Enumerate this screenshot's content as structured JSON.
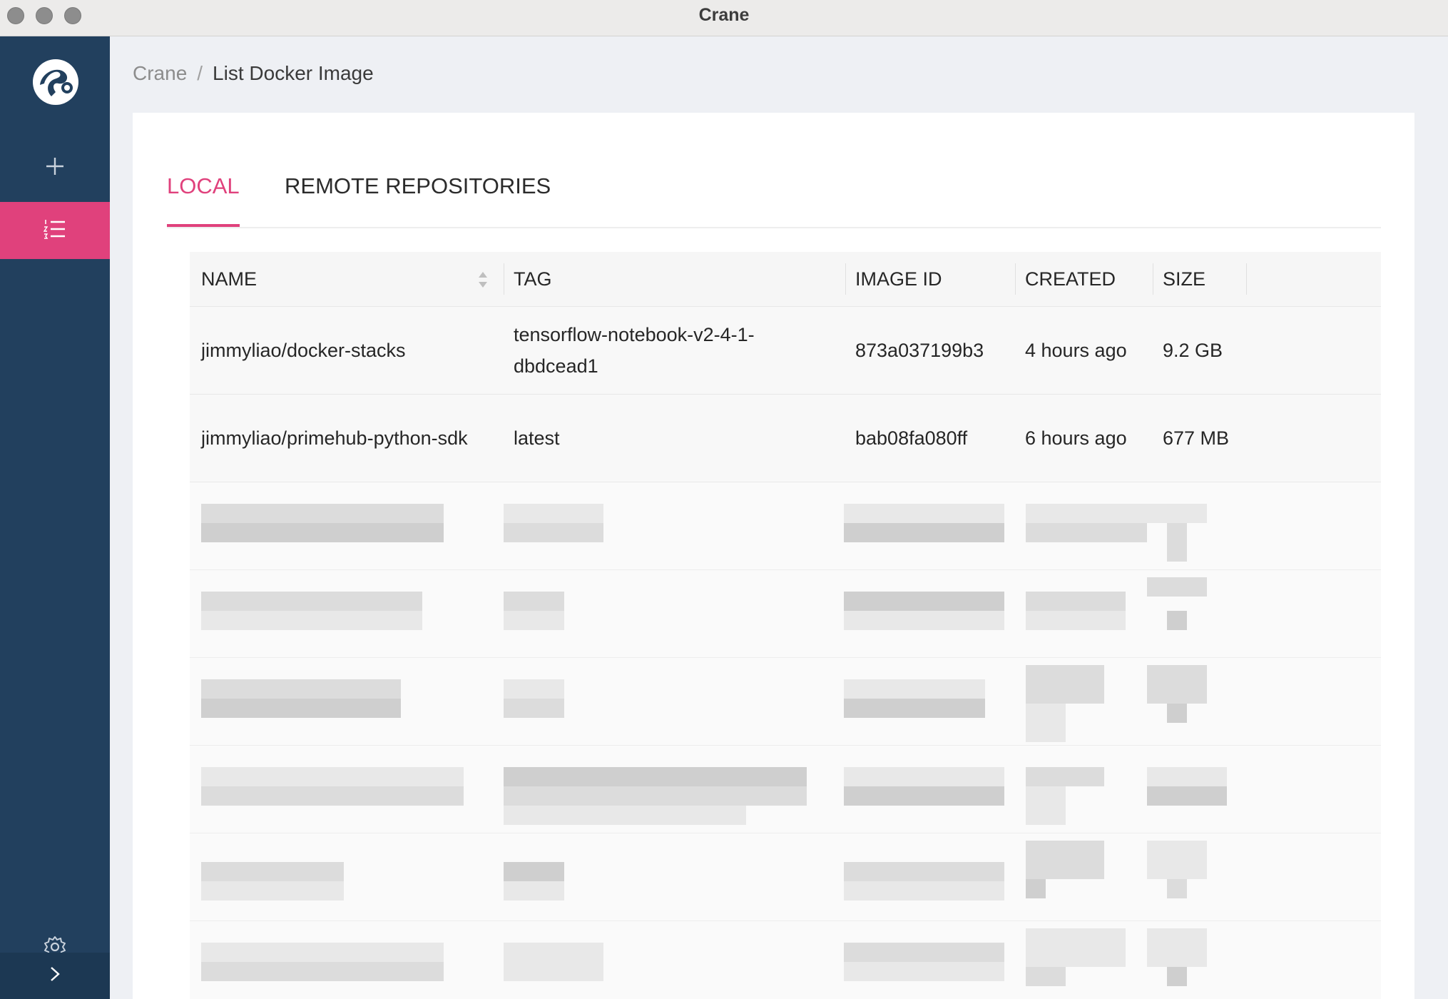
{
  "window": {
    "title": "Crane"
  },
  "sidebar": {
    "items": [
      {
        "name": "logo",
        "icon": "crane-logo-icon"
      },
      {
        "name": "add",
        "icon": "plus-icon"
      },
      {
        "name": "list",
        "icon": "list-icon",
        "active": true
      },
      {
        "name": "settings",
        "icon": "gear-icon"
      },
      {
        "name": "expand",
        "icon": "chevron-right-icon"
      }
    ],
    "colors": {
      "background": "#22405e",
      "active": "#e0417c"
    }
  },
  "breadcrumb": {
    "root": "Crane",
    "separator": "/",
    "current": "List Docker Image"
  },
  "tabs": [
    {
      "label": "LOCAL",
      "active": true
    },
    {
      "label": "REMOTE REPOSITORIES",
      "active": false
    }
  ],
  "table": {
    "columns": [
      "NAME",
      "TAG",
      "IMAGE ID",
      "CREATED",
      "SIZE"
    ],
    "rows": [
      {
        "name": "jimmyliao/docker-stacks",
        "tag": "tensorflow-notebook-v2-4-1-dbdcead1",
        "image_id": "873a037199b3",
        "created": "4 hours ago",
        "size": "9.2 GB"
      },
      {
        "name": "jimmyliao/primehub-python-sdk",
        "tag": "latest",
        "image_id": "bab08fa080ff",
        "created": "6 hours ago",
        "size": "677 MB"
      }
    ],
    "redacted_row_count": 6
  },
  "colors": {
    "accent": "#e0417c",
    "page_background": "#eef0f4",
    "card_background": "#ffffff"
  }
}
